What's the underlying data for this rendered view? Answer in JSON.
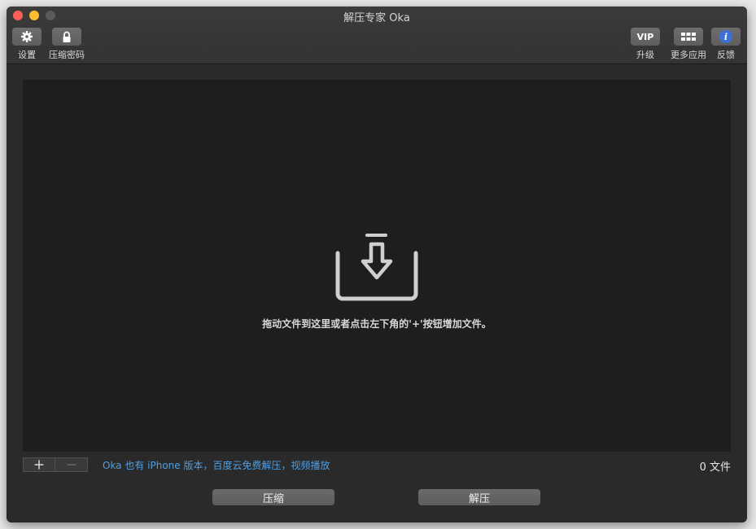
{
  "window": {
    "title": "解压专家 Oka"
  },
  "toolbar": {
    "settings_label": "设置",
    "password_label": "压缩密码",
    "vip_badge": "VIP",
    "upgrade_label": "升级",
    "more_apps_label": "更多应用",
    "feedback_label": "反馈",
    "feedback_icon_glyph": "i"
  },
  "drop_area": {
    "hint": "拖动文件到这里或者点击左下角的'+'按钮增加文件。"
  },
  "bottom": {
    "promo_link": "Oka 也有 iPhone 版本，百度云免费解压，视频播放",
    "file_count": "0 文件"
  },
  "actions": {
    "compress_label": "压缩",
    "extract_label": "解压"
  },
  "colors": {
    "link": "#4f9fe6",
    "feedback_icon": "#3c6fd8",
    "close": "#ff5f57",
    "minimize": "#febc2e"
  }
}
